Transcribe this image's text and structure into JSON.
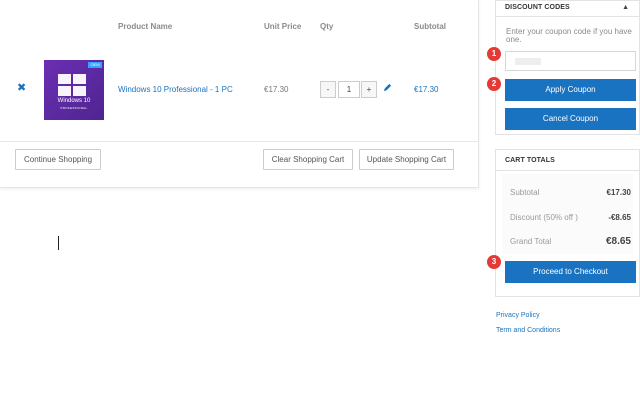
{
  "cart": {
    "headers": {
      "product_name": "Product Name",
      "unit_price": "Unit Price",
      "qty": "Qty",
      "subtotal": "Subtotal"
    },
    "item": {
      "remove_glyph": "✖",
      "thumb_badge": "OEM",
      "thumb_title": "Windows 10",
      "thumb_sub": "PROFESSIONAL",
      "name": "Windows 10 Professional - 1 PC",
      "unit_price": "€17.30",
      "qty_minus": "-",
      "qty": "1",
      "qty_plus": "+",
      "subtotal": "€17.30"
    },
    "buttons": {
      "continue": "Continue Shopping",
      "clear": "Clear Shopping Cart",
      "update": "Update Shopping Cart"
    }
  },
  "discount": {
    "title": "DISCOUNT CODES",
    "collapse_glyph": "▲",
    "hint": "Enter your coupon code if you have one.",
    "coupon_value": "",
    "apply_label": "Apply Coupon",
    "cancel_label": "Cancel Coupon"
  },
  "totals": {
    "title": "CART TOTALS",
    "subtotal_label": "Subtotal",
    "subtotal_value": "€17.30",
    "discount_label": "Discount (50% off )",
    "discount_value": "-€8.65",
    "grand_label": "Grand Total",
    "grand_value": "€8.65",
    "checkout_label": "Proceed to Checkout"
  },
  "markers": [
    "1",
    "2",
    "3"
  ],
  "footer_links": [
    "Privacy Policy",
    "Term and Conditions"
  ],
  "colors": {
    "accent": "#1a73c0",
    "marker": "#e53935",
    "product_purple": "#5a2aa0"
  }
}
